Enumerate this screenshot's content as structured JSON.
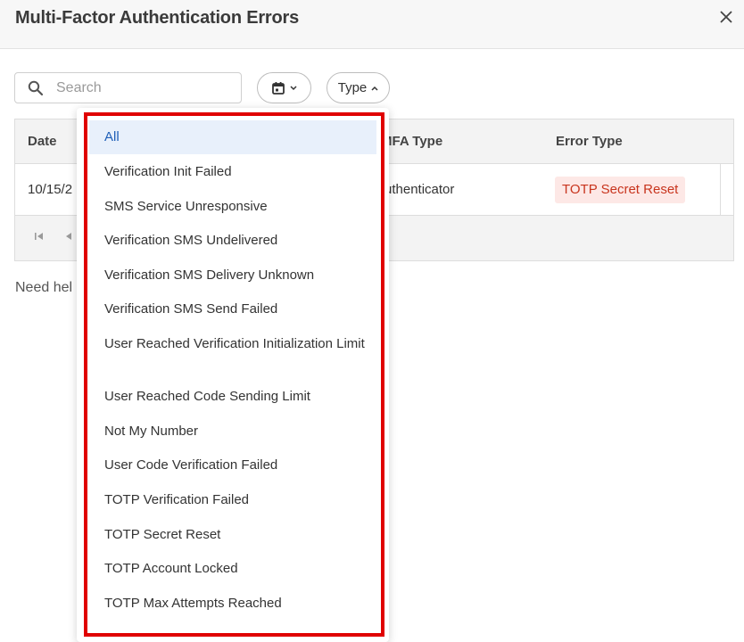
{
  "dialog": {
    "title": "Multi-Factor Authentication Errors"
  },
  "filters": {
    "search_placeholder": "Search",
    "type_label": "Type"
  },
  "table": {
    "columns": [
      "Date",
      "MFA Type",
      "Error Type"
    ],
    "row": {
      "date": "10/15/2",
      "mfa_type": "uthenticator",
      "error_type": "TOTP Secret Reset"
    }
  },
  "help_text": "Need hel",
  "type_dropdown": {
    "selected": "All",
    "options": [
      "All",
      "Verification Init Failed",
      "SMS Service Unresponsive",
      "Verification SMS Undelivered",
      "Verification SMS Delivery Unknown",
      "Verification SMS Send Failed",
      "User Reached Verification Initialization Limit",
      "User Reached Code Sending Limit",
      "Not My Number",
      "User Code Verification Failed",
      "TOTP Verification Failed",
      "TOTP Secret Reset",
      "TOTP Account Locked",
      "TOTP Max Attempts Reached"
    ]
  },
  "colors": {
    "highlight_border": "#e00000",
    "selected_bg": "#e8f0fb",
    "selected_text": "#1f5fb8",
    "badge_bg": "#fde8e6",
    "badge_text": "#c8341d"
  }
}
